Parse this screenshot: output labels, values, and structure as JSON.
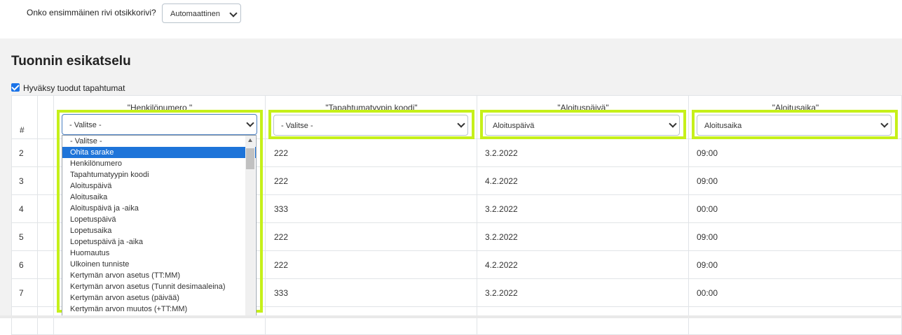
{
  "header": {
    "question": "Onko ensimmäinen rivi otsikkorivi?",
    "header_row_select": "Automaattinen"
  },
  "preview": {
    "title": "Tuonnin esikatselu",
    "approve_label": "Hyväksy tuodut tapahtumat",
    "row_header": "#",
    "columns": [
      {
        "header": "\"Henkilönumero \"",
        "selected": "- Valitse -"
      },
      {
        "header": "\"Tapahtumatyypin koodi\"",
        "selected": "- Valitse -"
      },
      {
        "header": "\"Aloituspäivä\"",
        "selected": "Aloituspäivä"
      },
      {
        "header": "\"Aloitusaika\"",
        "selected": "Aloitusaika"
      }
    ],
    "rows": [
      {
        "num": "2",
        "code": "222",
        "date": "3.2.2022",
        "time": "09:00"
      },
      {
        "num": "3",
        "code": "222",
        "date": "4.2.2022",
        "time": "09:00"
      },
      {
        "num": "4",
        "code": "333",
        "date": "3.2.2022",
        "time": "00:00"
      },
      {
        "num": "5",
        "code": "222",
        "date": "3.2.2022",
        "time": "09:00"
      },
      {
        "num": "6",
        "code": "222",
        "date": "4.2.2022",
        "time": "09:00"
      },
      {
        "num": "7",
        "code": "333",
        "date": "3.2.2022",
        "time": "00:00"
      }
    ]
  },
  "dropdown": {
    "options": [
      "- Valitse -",
      "Ohita sarake",
      "Henkilönumero",
      "Tapahtumatyypin koodi",
      "Aloituspäivä",
      "Aloitusaika",
      "Aloituspäivä ja -aika",
      "Lopetuspäivä",
      "Lopetusaika",
      "Lopetuspäivä ja -aika",
      "Huomautus",
      "Ulkoinen tunniste",
      "Kertymän arvon asetus (TT:MM)",
      "Kertymän arvon asetus (Tunnit desimaaleina)",
      "Kertymän arvon asetus (päivää)",
      "Kertymän arvon muutos (+TT:MM)"
    ],
    "highlighted": "Ohita sarake"
  },
  "colors": {
    "highlight": "#c6f01a",
    "selected_option": "#1e74d9",
    "row_number": "#2c5d8f"
  }
}
